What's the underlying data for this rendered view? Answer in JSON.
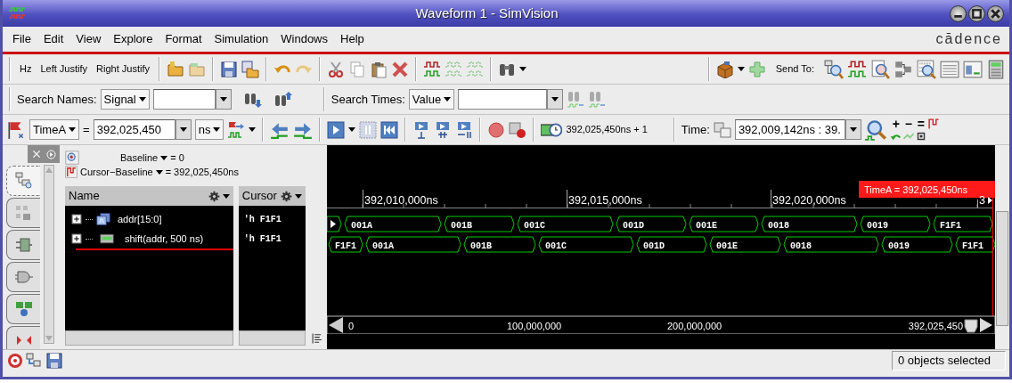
{
  "window": {
    "title": "Waveform 1 - SimVision"
  },
  "menu": [
    "File",
    "Edit",
    "View",
    "Explore",
    "Format",
    "Simulation",
    "Windows",
    "Help"
  ],
  "logo": "cādence",
  "toolbar": {
    "buttons": [
      "Hz",
      "Left Justify",
      "Right Justify"
    ],
    "send_to_label": "Send To:"
  },
  "search_names": {
    "label": "Search Names:",
    "scope": "Signal"
  },
  "search_times": {
    "label": "Search Times:",
    "scope": "Value"
  },
  "cursor_bar": {
    "cursor": "TimeA",
    "equals": "=",
    "time": "392,025,450",
    "unit": "ns",
    "marker_time": "392,025,450ns + 1",
    "time_label": "Time:",
    "range": "392,009,142ns : 39.",
    "zoom_buttons": [
      "+",
      "−",
      "="
    ]
  },
  "side_tabs": [
    {
      "selected": true
    },
    {
      "selected": false
    },
    {
      "selected": false
    },
    {
      "selected": false
    },
    {
      "selected": false
    },
    {
      "selected": false
    }
  ],
  "baseline": {
    "label": "Baseline",
    "value": "= 0",
    "delta_label": "Cursor−Baseline",
    "delta_value": "= 392,025,450ns"
  },
  "signals": {
    "columns": [
      "Name",
      "Cursor"
    ],
    "rows": [
      {
        "name": "addr[15:0]",
        "cursor": "'h F1F1",
        "expanded": false,
        "insertion_point": false
      },
      {
        "name": "shift(addr, 500 ns)",
        "cursor": "'h F1F1",
        "expanded": false,
        "insertion_point": true
      }
    ]
  },
  "waveform": {
    "marker": "TimeA = 392,025,450ns",
    "timeline": [
      "392,010,000ns",
      "392,015,000ns",
      "392,020,000ns",
      "3"
    ],
    "traces": [
      {
        "continues_left": true,
        "segments": [
          "001A",
          "001B",
          "001C",
          "001D",
          "001E",
          "0018",
          "0019",
          "F1F1"
        ]
      },
      {
        "continues_left": false,
        "segments": [
          "F1F1",
          "001A",
          "001B",
          "001C",
          "001D",
          "001E",
          "0018",
          "0019",
          "F1F1"
        ]
      }
    ],
    "overview": [
      "0",
      "100,000,000",
      "200,000,000",
      "392,025,450"
    ]
  },
  "status": "0 objects selected"
}
